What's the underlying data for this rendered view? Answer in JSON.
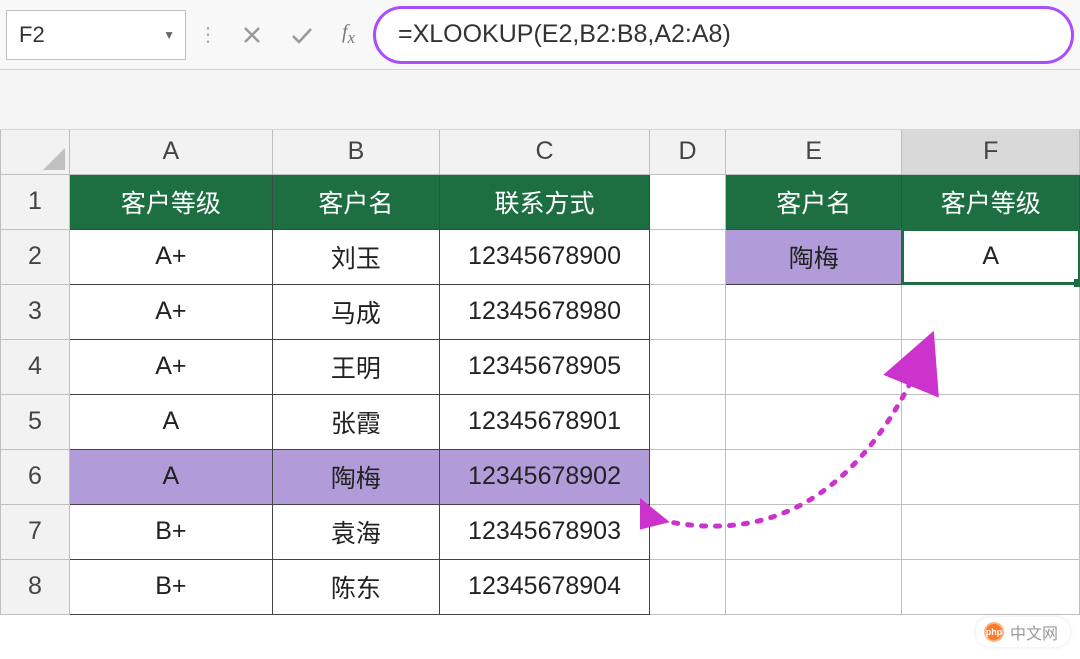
{
  "formula_bar": {
    "cell_ref": "F2",
    "formula": "=XLOOKUP(E2,B2:B8,A2:A8)"
  },
  "columns": [
    "A",
    "B",
    "C",
    "D",
    "E",
    "F"
  ],
  "row_numbers": [
    "1",
    "2",
    "3",
    "4",
    "5",
    "6",
    "7",
    "8"
  ],
  "headers": {
    "A": "客户等级",
    "B": "客户名",
    "C": "联系方式",
    "E": "客户名",
    "F": "客户等级"
  },
  "data_rows": [
    {
      "A": "A+",
      "B": "刘玉",
      "C": "12345678900"
    },
    {
      "A": "A+",
      "B": "马成",
      "C": "12345678980"
    },
    {
      "A": "A+",
      "B": "王明",
      "C": "12345678905"
    },
    {
      "A": "A",
      "B": "张霞",
      "C": "12345678901"
    },
    {
      "A": "A",
      "B": "陶梅",
      "C": "12345678902"
    },
    {
      "A": "B+",
      "B": "袁海",
      "C": "12345678903"
    },
    {
      "A": "B+",
      "B": "陈东",
      "C": "12345678904"
    }
  ],
  "lookup": {
    "E2": "陶梅",
    "F2": "A"
  },
  "watermark": "中文网"
}
